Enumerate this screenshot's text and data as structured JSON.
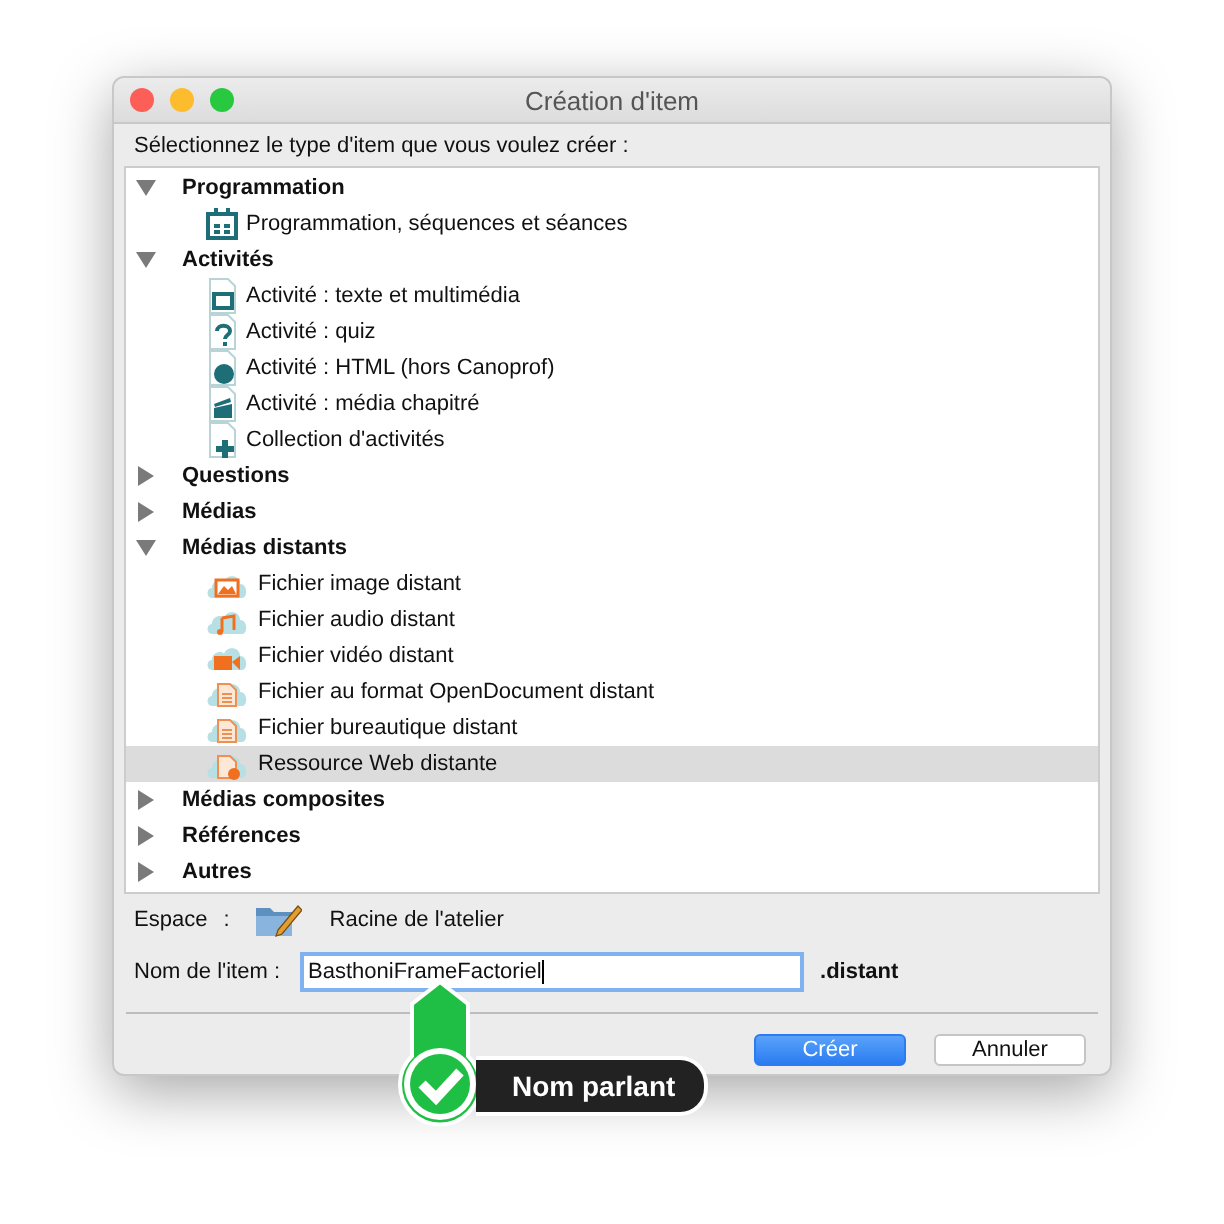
{
  "window": {
    "title": "Création d'item"
  },
  "prompt": "Sélectionnez le type d'item que vous voulez créer :",
  "tree": [
    {
      "label": "Programmation",
      "expanded": true,
      "selected": false,
      "children": [
        {
          "label": "Programmation, séquences et séances",
          "kind": "calendar",
          "selected": false
        }
      ]
    },
    {
      "label": "Activités",
      "expanded": true,
      "selected": false,
      "children": [
        {
          "label": "Activité : texte et multimédia",
          "kind": "screen",
          "selected": false
        },
        {
          "label": "Activité : quiz",
          "kind": "quiz",
          "selected": false
        },
        {
          "label": "Activité : HTML (hors Canoprof)",
          "kind": "globe",
          "selected": false
        },
        {
          "label": "Activité : média chapitré",
          "kind": "clapper",
          "selected": false
        },
        {
          "label": "Collection d'activités",
          "kind": "plus",
          "selected": false
        }
      ]
    },
    {
      "label": "Questions",
      "expanded": false,
      "selected": false
    },
    {
      "label": "Médias",
      "expanded": false,
      "selected": false
    },
    {
      "label": "Médias distants",
      "expanded": true,
      "selected": false,
      "children": [
        {
          "label": "Fichier image distant",
          "kind": "cloud-image",
          "selected": false
        },
        {
          "label": "Fichier audio distant",
          "kind": "cloud-audio",
          "selected": false
        },
        {
          "label": "Fichier vidéo distant",
          "kind": "cloud-video",
          "selected": false
        },
        {
          "label": "Fichier au format OpenDocument distant",
          "kind": "cloud-doc",
          "selected": false
        },
        {
          "label": "Fichier bureautique distant",
          "kind": "cloud-doc",
          "selected": false
        },
        {
          "label": "Ressource Web distante",
          "kind": "cloud-web",
          "selected": true
        }
      ]
    },
    {
      "label": "Médias composites",
      "expanded": false,
      "selected": false
    },
    {
      "label": "Références",
      "expanded": false,
      "selected": false
    },
    {
      "label": "Autres",
      "expanded": false,
      "selected": false
    }
  ],
  "space": {
    "label": "Espace",
    "separator": ":",
    "value": "Racine de l'atelier"
  },
  "name_field": {
    "label": "Nom de l'item :",
    "value": "BasthoniFrameFactoriel",
    "suffix": ".distant"
  },
  "buttons": [
    {
      "label": "Créer",
      "kind": "primary"
    },
    {
      "label": "Annuler",
      "kind": "normal"
    }
  ],
  "callout": {
    "label": "Nom parlant"
  }
}
